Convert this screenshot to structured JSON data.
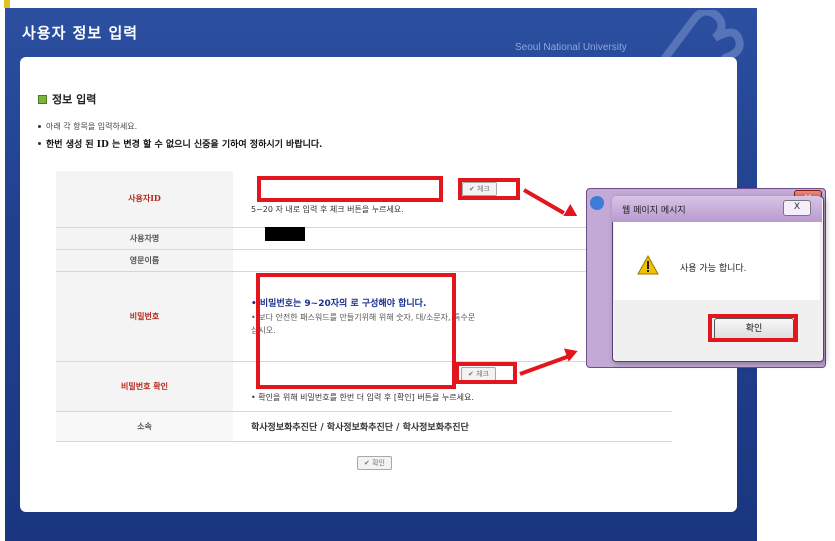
{
  "window": {
    "title": "사용자 정보 입력",
    "university": "Seoul National University"
  },
  "section": {
    "title": "정보 입력",
    "note1": "아래 각 항목을 입력하세요.",
    "note2": "한번 생성 된 ID 는 변경 할 수 없으니 신중을 기하여 정하시기 바랍니다."
  },
  "form": {
    "rows": [
      {
        "label": "사용자ID",
        "hint": "5~20 자 내로 입력 후 체크 버튼을 누르세요.",
        "button": "체크"
      },
      {
        "label": "사용자명"
      },
      {
        "label": "영문이름"
      },
      {
        "label": "비밀번호",
        "hint1": "• 비밀번호는 9~20자의 로 구성해야 합니다.",
        "hint2": "• 보다 안전한 패스워드를 만들기위해 위해 숫자, 대/소문자, 특수문",
        "hint3": "십시오."
      },
      {
        "label": "비밀번호 확인",
        "hint": "• 확인을 위해 비밀번호를 한번 더 입력 후 [확인] 버튼을 누르세요.",
        "button": "체크"
      },
      {
        "label": "소속",
        "value": "학사정보화추진단 / 학사정보화추진단 / 학사정보화추진단"
      }
    ],
    "submit": "확인"
  },
  "dialog": {
    "title": "웹 페이지 메시지",
    "message": "사용 가능 합니다.",
    "ok": "확인",
    "close": "X"
  },
  "colors": {
    "frame": "#21418f",
    "highlight": "#e3151d",
    "label_red": "#b5281e",
    "hint_blue": "#1a2f8f"
  }
}
